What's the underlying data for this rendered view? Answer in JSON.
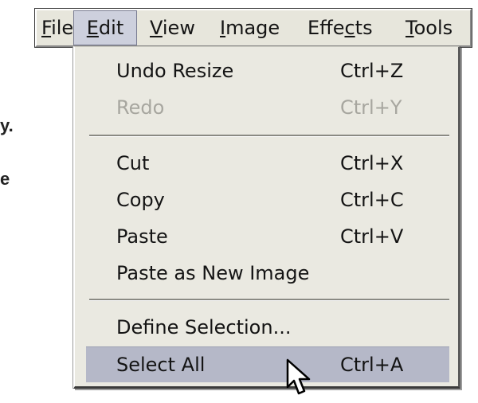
{
  "background": {
    "text_fragments": [
      "y.",
      "e"
    ]
  },
  "menubar": {
    "items": [
      {
        "label": "File",
        "mnemonic": "F",
        "rest": "ile"
      },
      {
        "label": "Edit",
        "mnemonic": "E",
        "rest": "dit"
      },
      {
        "label": "View",
        "mnemonic": "V",
        "rest": "iew"
      },
      {
        "label": "Image",
        "mnemonic": "I",
        "rest": "mage"
      },
      {
        "label": "Effects",
        "pre": "Effe",
        "mnemonic": "c",
        "rest": "ts"
      },
      {
        "label": "Tools",
        "mnemonic": "T",
        "rest": "ools"
      }
    ],
    "active": "Edit"
  },
  "edit_menu": {
    "items": [
      {
        "label": "Undo Resize",
        "shortcut": "Ctrl+Z",
        "enabled": true
      },
      {
        "label": "Redo",
        "shortcut": "Ctrl+Y",
        "enabled": false
      },
      {
        "label": "Cut",
        "shortcut": "Ctrl+X",
        "enabled": true
      },
      {
        "label": "Copy",
        "shortcut": "Ctrl+C",
        "enabled": true
      },
      {
        "label": "Paste",
        "shortcut": "Ctrl+V",
        "enabled": true
      },
      {
        "label": "Paste as New Image",
        "shortcut": "",
        "enabled": true
      },
      {
        "label": "Define Selection...",
        "shortcut": "",
        "enabled": true
      },
      {
        "label": "Select All",
        "shortcut": "Ctrl+A",
        "enabled": true,
        "highlighted": true
      }
    ]
  },
  "icons": {
    "cursor": "mouse-pointer-icon"
  },
  "colors": {
    "menubar_bg": "#e7e6dc",
    "menu_bg": "#eae9e1",
    "highlight": "#b5b8c8",
    "disabled_text": "#a7a69f"
  }
}
